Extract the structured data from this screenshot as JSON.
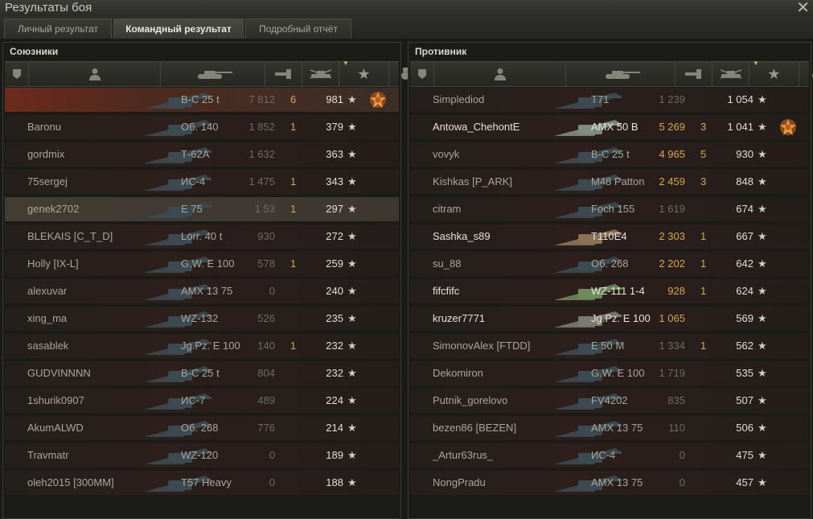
{
  "window": {
    "title": "Результаты боя",
    "close": "✕"
  },
  "tabs": [
    {
      "label": "Личный результат",
      "active": false
    },
    {
      "label": "Командный результат",
      "active": true
    },
    {
      "label": "Подробный отчёт",
      "active": false
    }
  ],
  "teams": [
    {
      "title": "Союзники",
      "rows": [
        {
          "name": "",
          "vehicle": "В-С 25 t",
          "xp": "7 812",
          "kills": "6",
          "score": "981",
          "medal": true,
          "style": "self"
        },
        {
          "name": "Baronu",
          "vehicle": "Об. 140",
          "xp": "1 852",
          "kills": "1",
          "score": "379"
        },
        {
          "name": "gordmix",
          "vehicle": "Т-62А",
          "xp": "1 632",
          "kills": "",
          "score": "363"
        },
        {
          "name": "75sergej",
          "vehicle": "ИС-4",
          "xp": "1 475",
          "kills": "1",
          "score": "343"
        },
        {
          "name": "genek2702",
          "vehicle": "E 75",
          "xp": "1 53",
          "kills": "1",
          "score": "297",
          "style": "hl"
        },
        {
          "name": "BLEKAIS [C_T_D]",
          "vehicle": "Lorr. 40 t",
          "xp": "930",
          "kills": "",
          "score": "272"
        },
        {
          "name": "Holly [IX-L]",
          "vehicle": "G.W. E 100",
          "xp": "578",
          "kills": "1",
          "score": "259"
        },
        {
          "name": "alexuvar",
          "vehicle": "AMX 13 75",
          "xp": "0",
          "kills": "",
          "score": "240"
        },
        {
          "name": "xing_ma",
          "vehicle": "WZ-132",
          "xp": "526",
          "kills": "",
          "score": "235"
        },
        {
          "name": "sasablek",
          "vehicle": "Jg.Pz. E 100",
          "xp": "140",
          "kills": "1",
          "score": "232"
        },
        {
          "name": "GUDVINNNN",
          "vehicle": "В-С 25 t",
          "xp": "804",
          "kills": "",
          "score": "232"
        },
        {
          "name": "1shurik0907",
          "vehicle": "ИС-7",
          "xp": "489",
          "kills": "",
          "score": "224"
        },
        {
          "name": "AkumALWD",
          "vehicle": "Об. 268",
          "xp": "776",
          "kills": "",
          "score": "214"
        },
        {
          "name": "Travmatr",
          "vehicle": "WZ-120",
          "xp": "0",
          "kills": "",
          "score": "189"
        },
        {
          "name": "oleh2015 [300MM]",
          "vehicle": "T57 Heavy",
          "xp": "0",
          "kills": "",
          "score": "188"
        }
      ]
    },
    {
      "title": "Противник",
      "rows": [
        {
          "name": "Simplediod",
          "vehicle": "T71",
          "xp": "1 239",
          "kills": "",
          "score": "1 054"
        },
        {
          "name": "Antowa_ChehontE",
          "vehicle": "AMX 50 B",
          "xp": "5 269",
          "kills": "3",
          "score": "1 041",
          "medal": true,
          "alive": true,
          "tank": "#7e8c84"
        },
        {
          "name": "vovyk",
          "vehicle": "В-С 25 t",
          "xp": "4 965",
          "kills": "5",
          "score": "930"
        },
        {
          "name": "Kishkas [P_ARK]",
          "vehicle": "M48 Patton",
          "xp": "2 459",
          "kills": "3",
          "score": "848"
        },
        {
          "name": "citram",
          "vehicle": "Foch 155",
          "xp": "1 619",
          "kills": "",
          "score": "674"
        },
        {
          "name": "Sashka_s89",
          "vehicle": "T110E4",
          "xp": "2 303",
          "kills": "1",
          "score": "667",
          "alive": true,
          "tank": "#8a7256"
        },
        {
          "name": "su_88",
          "vehicle": "Об. 268",
          "xp": "2 202",
          "kills": "1",
          "score": "642"
        },
        {
          "name": "fifcfifc",
          "vehicle": "WZ-111 1-4",
          "xp": "928",
          "kills": "1",
          "score": "624",
          "alive": true,
          "tank": "#6e8a5e"
        },
        {
          "name": "kruzer7771",
          "vehicle": "Jg.Pz. E 100",
          "xp": "1 065",
          "kills": "",
          "score": "569",
          "alive": true,
          "tank": "#7a7a72"
        },
        {
          "name": "SimonovAlex [FTDD]",
          "vehicle": "E 50 M",
          "xp": "1 334",
          "kills": "1",
          "score": "562"
        },
        {
          "name": "Dekomiron",
          "vehicle": "G.W. E 100",
          "xp": "1 719",
          "kills": "",
          "score": "535"
        },
        {
          "name": "Putnik_gorelovo",
          "vehicle": "FV4202",
          "xp": "835",
          "kills": "",
          "score": "507"
        },
        {
          "name": "bezen86 [BEZEN]",
          "vehicle": "AMX 13 75",
          "xp": "110",
          "kills": "",
          "score": "506"
        },
        {
          "name": "_Artur63rus_",
          "vehicle": "ИС-4",
          "xp": "0",
          "kills": "",
          "score": "475"
        },
        {
          "name": "NongPradu",
          "vehicle": "AMX 13 75",
          "xp": "0",
          "kills": "",
          "score": "457"
        }
      ]
    }
  ],
  "icons": {
    "star": "★",
    "medal": "medal-icon",
    "sort": "▼"
  },
  "colors": {
    "xp_highlight": "#d6a84a",
    "self_row": "#6d2a1c"
  }
}
